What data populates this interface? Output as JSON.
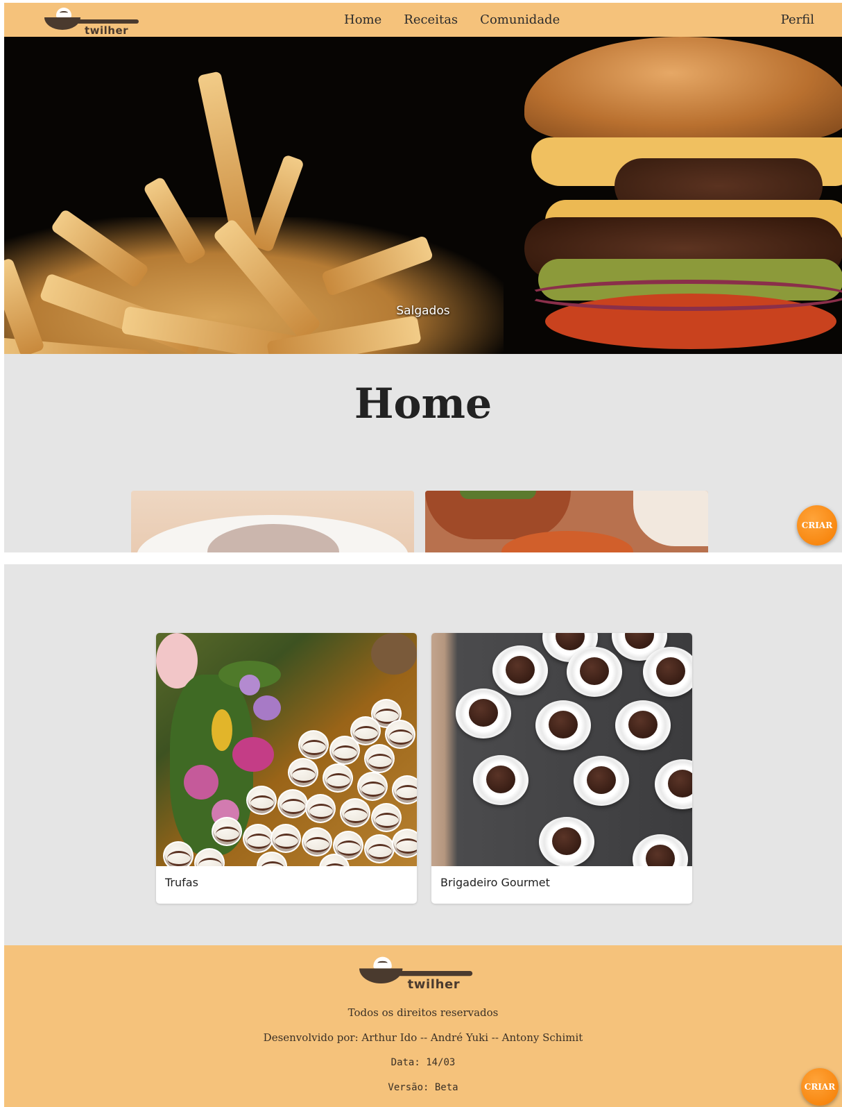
{
  "navbar": {
    "brand": "twilher",
    "links": [
      "Home",
      "Receitas",
      "Comunidade"
    ],
    "profile": "Perfil"
  },
  "hero": {
    "caption": "Salgados"
  },
  "page": {
    "title": "Home"
  },
  "fab": {
    "label": "CRIAR",
    "color": "#f57c00"
  },
  "recipes": [
    {
      "name": "Trufas"
    },
    {
      "name": "Brigadeiro Gourmet"
    }
  ],
  "footer": {
    "brand": "twilher",
    "rights": "Todos os direitos reservados",
    "developers": "Desenvolvido por: Arthur Ido -- André Yuki -- Antony Schimit",
    "date": "Data: 14/03",
    "version": "Versão: Beta"
  },
  "colors": {
    "navbar": "#f5c27b",
    "background": "#e5e5e5",
    "footer": "#f5c27b"
  }
}
